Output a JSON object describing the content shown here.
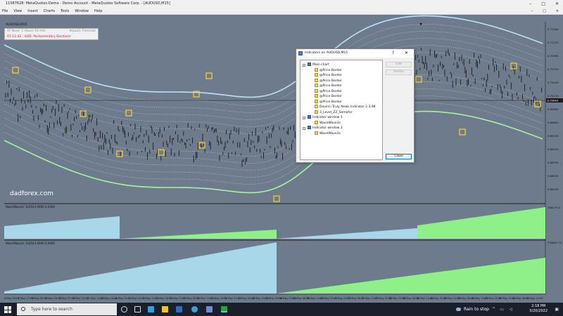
{
  "window": {
    "title": "11587628: MetaQuotes-Demo - Demo Account - MetaQuotes Software Corp. - [AUDUSD,M15]",
    "controls": [
      "–",
      "□",
      "✕"
    ],
    "inner_controls": [
      "–",
      "□",
      "✕"
    ]
  },
  "menu": [
    "File",
    "View",
    "Insert",
    "Charts",
    "Tools",
    "Window",
    "Help"
  ],
  "chart": {
    "symbol_label": "AUDUSD,M15",
    "info": {
      "row1_left": "AT Next: 1 Hours 10 min",
      "row1_right": "Impact: Forecast",
      "row2": "07:11:42 : AUD: Parliamentary Elections"
    },
    "watermark": "dadforex.com",
    "subwindow1_label": "WaveWave3c 324543.0000 0.0000",
    "subwindow2_label": "WaveWave3c 324543.0000 0.0000",
    "price_labels": [
      "0.71545",
      "0.71270",
      "0.70995",
      "0.70720",
      "0.70445",
      "0.70170",
      "0.69895",
      "0.69620",
      "0.69345",
      "0.69070",
      "0.68795",
      "0.68520",
      "0.68245"
    ],
    "current_price": "0.70043",
    "sub1_scale": [
      "396270.0",
      "0.00"
    ],
    "sub2_scale": [
      "734807.12",
      "0.00"
    ],
    "time_labels": [
      "6 May 2022",
      "6 May 17:00",
      "9 May 06:00",
      "9 May 16:00",
      "9 May 22:00",
      "9 May 22:00",
      "10 May 10:00",
      "10 May 16:00",
      "10 May 22:00",
      "11 May 04:00",
      "11 May 10:00",
      "11 May 16:00",
      "11 May 22:00",
      "12 May 04:00",
      "12 May 10:00",
      "12 May 16:00",
      "12 May 22:00",
      "13 May 04:00",
      "13 May 10:00",
      "13 May 16:00",
      "16 May 02:45",
      "16 May 08:45",
      "16 May 14:45",
      "16 May 20:45",
      "17 May 02:45",
      "17 May 08:45",
      "17 May 14:45",
      "17 May 20:45",
      "18 May 02:45",
      "18 May 08:45",
      "18 May 14:45",
      "18 May 20:45",
      "19 May 02:45",
      "19 May 08:45",
      "19 May 14:45",
      "19 May 20:45",
      "20 May 02:45",
      "20 May 08:45",
      "20 May 14:45"
    ],
    "colors": {
      "background": "#6d7b8d",
      "candles": "#1c1c1c",
      "band_outer_upper": "#b9e3f5",
      "band_outer_lower": "#a8f2a0",
      "band_inner": "#c6ccd4",
      "histogram_blue": "#a9d7ea",
      "histogram_green": "#8ff08a",
      "fractal_box": "#ffd21f"
    }
  },
  "dialog": {
    "title": "Indicators on AUDUSD,M15",
    "help": "?",
    "close": "✕",
    "tree": [
      {
        "label": "Main chart",
        "level": 0,
        "icon": "folder-icon"
      },
      {
        "label": "@Price Border",
        "level": 1,
        "icon": "indicator-icon"
      },
      {
        "label": "@Price Border",
        "level": 1,
        "icon": "indicator-icon"
      },
      {
        "label": "@Price Border",
        "level": 1,
        "icon": "indicator-icon"
      },
      {
        "label": "@Price Border",
        "level": 1,
        "icon": "indicator-icon"
      },
      {
        "label": "@Price Border",
        "level": 1,
        "icon": "indicator-icon"
      },
      {
        "label": "@Price Border",
        "level": 1,
        "icon": "indicator-icon"
      },
      {
        "label": "@Price Border",
        "level": 1,
        "icon": "indicator-icon"
      },
      {
        "label": "Davinci Truly News Indicator 2.3.98",
        "level": 1,
        "icon": "indicator-icon"
      },
      {
        "label": "3_Level_ZZ_Semafor",
        "level": 1,
        "icon": "indicator-icon"
      },
      {
        "label": "Indicator window 1",
        "level": 0,
        "icon": "folder-icon"
      },
      {
        "label": "WaveWave3c",
        "level": 1,
        "icon": "indicator-icon"
      },
      {
        "label": "Indicator window 2",
        "level": 0,
        "icon": "folder-icon"
      },
      {
        "label": "WaveWave3c",
        "level": 1,
        "icon": "indicator-icon"
      }
    ],
    "buttons": {
      "edit": "Edit",
      "delete": "Delete",
      "close": "Close"
    }
  },
  "taskbar": {
    "search_placeholder": "Type here to search",
    "weather": "Rain to stop",
    "time": "2:18 PM",
    "date": "5/20/2022"
  }
}
